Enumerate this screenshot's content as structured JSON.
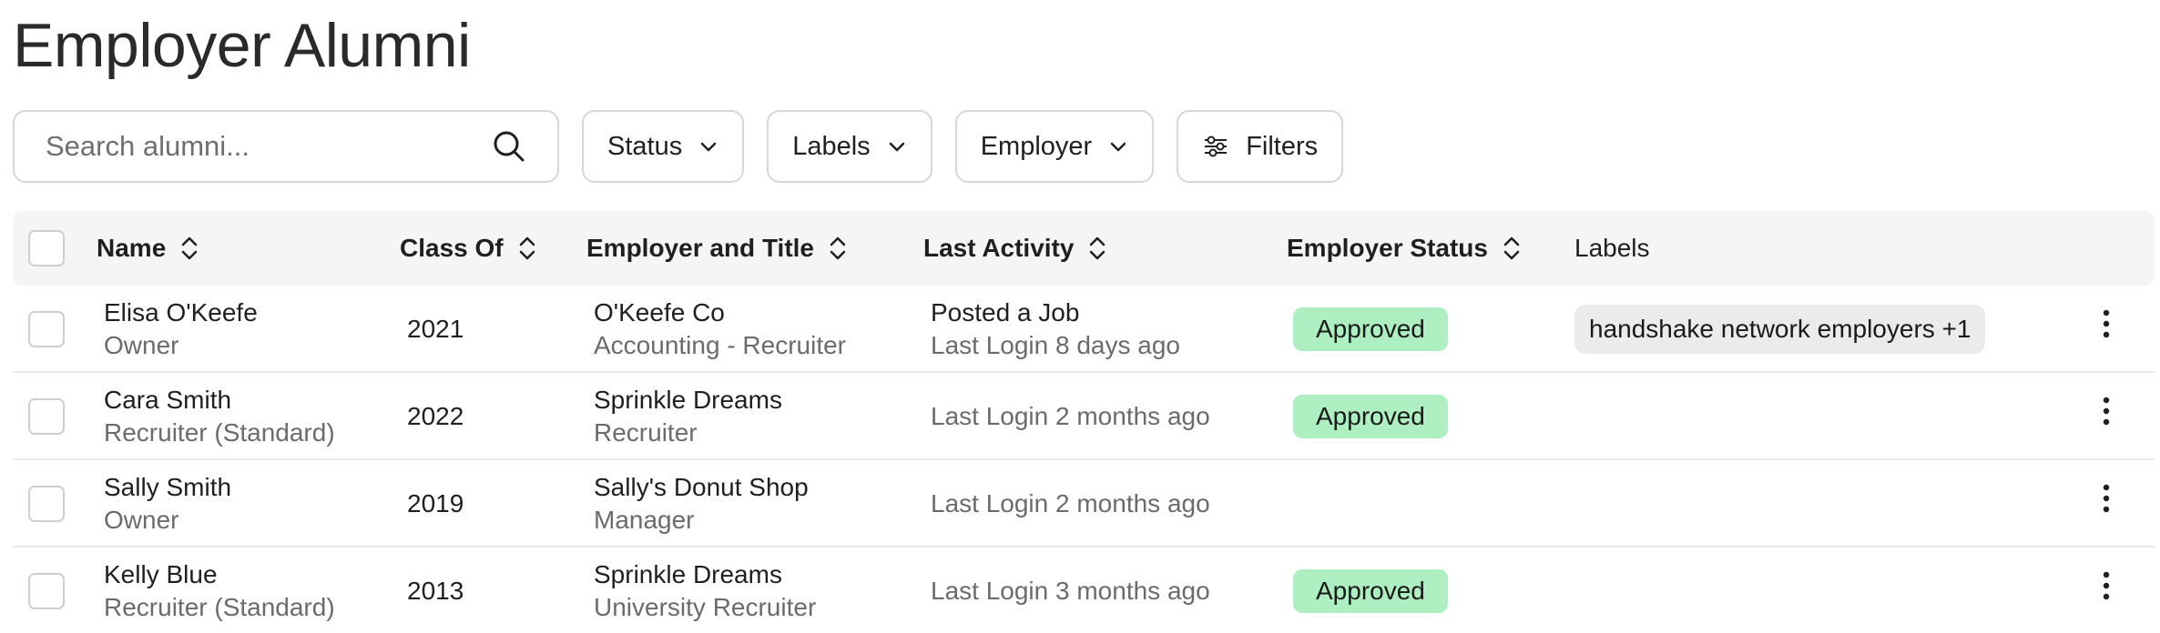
{
  "page": {
    "title": "Employer Alumni"
  },
  "search": {
    "placeholder": "Search alumni..."
  },
  "filters": {
    "status_label": "Status",
    "labels_label": "Labels",
    "employer_label": "Employer",
    "filters_label": "Filters"
  },
  "table": {
    "columns": {
      "name": "Name",
      "class_of": "Class Of",
      "employer_title": "Employer and Title",
      "last_activity": "Last Activity",
      "employer_status": "Employer Status",
      "labels": "Labels"
    },
    "rows": [
      {
        "name": "Elisa O'Keefe",
        "role": "Owner",
        "class_of": "2021",
        "employer": "O'Keefe Co",
        "title": "Accounting - Recruiter",
        "activity_primary": "Posted a Job",
        "activity_secondary": "Last Login 8 days ago",
        "status": "Approved",
        "label": "handshake network employers +1"
      },
      {
        "name": "Cara Smith",
        "role": "Recruiter (Standard)",
        "class_of": "2022",
        "employer": "Sprinkle Dreams",
        "title": "Recruiter",
        "activity": "Last Login 2 months ago",
        "status": "Approved"
      },
      {
        "name": "Sally Smith",
        "role": "Owner",
        "class_of": "2019",
        "employer": "Sally's Donut Shop",
        "title": "Manager",
        "activity": "Last Login 2 months ago"
      },
      {
        "name": "Kelly Blue",
        "role": "Recruiter (Standard)",
        "class_of": "2013",
        "employer": "Sprinkle Dreams",
        "title": "University Recruiter",
        "activity": "Last Login 3 months ago",
        "status": "Approved"
      }
    ]
  },
  "colors": {
    "approved_badge": "#aeefc2",
    "label_chip": "#ebebeb",
    "header_bg": "#f5f5f5"
  },
  "icons": [
    "search-icon",
    "chevron-down-icon",
    "sliders-icon",
    "sort-icon",
    "more-vertical-icon"
  ]
}
